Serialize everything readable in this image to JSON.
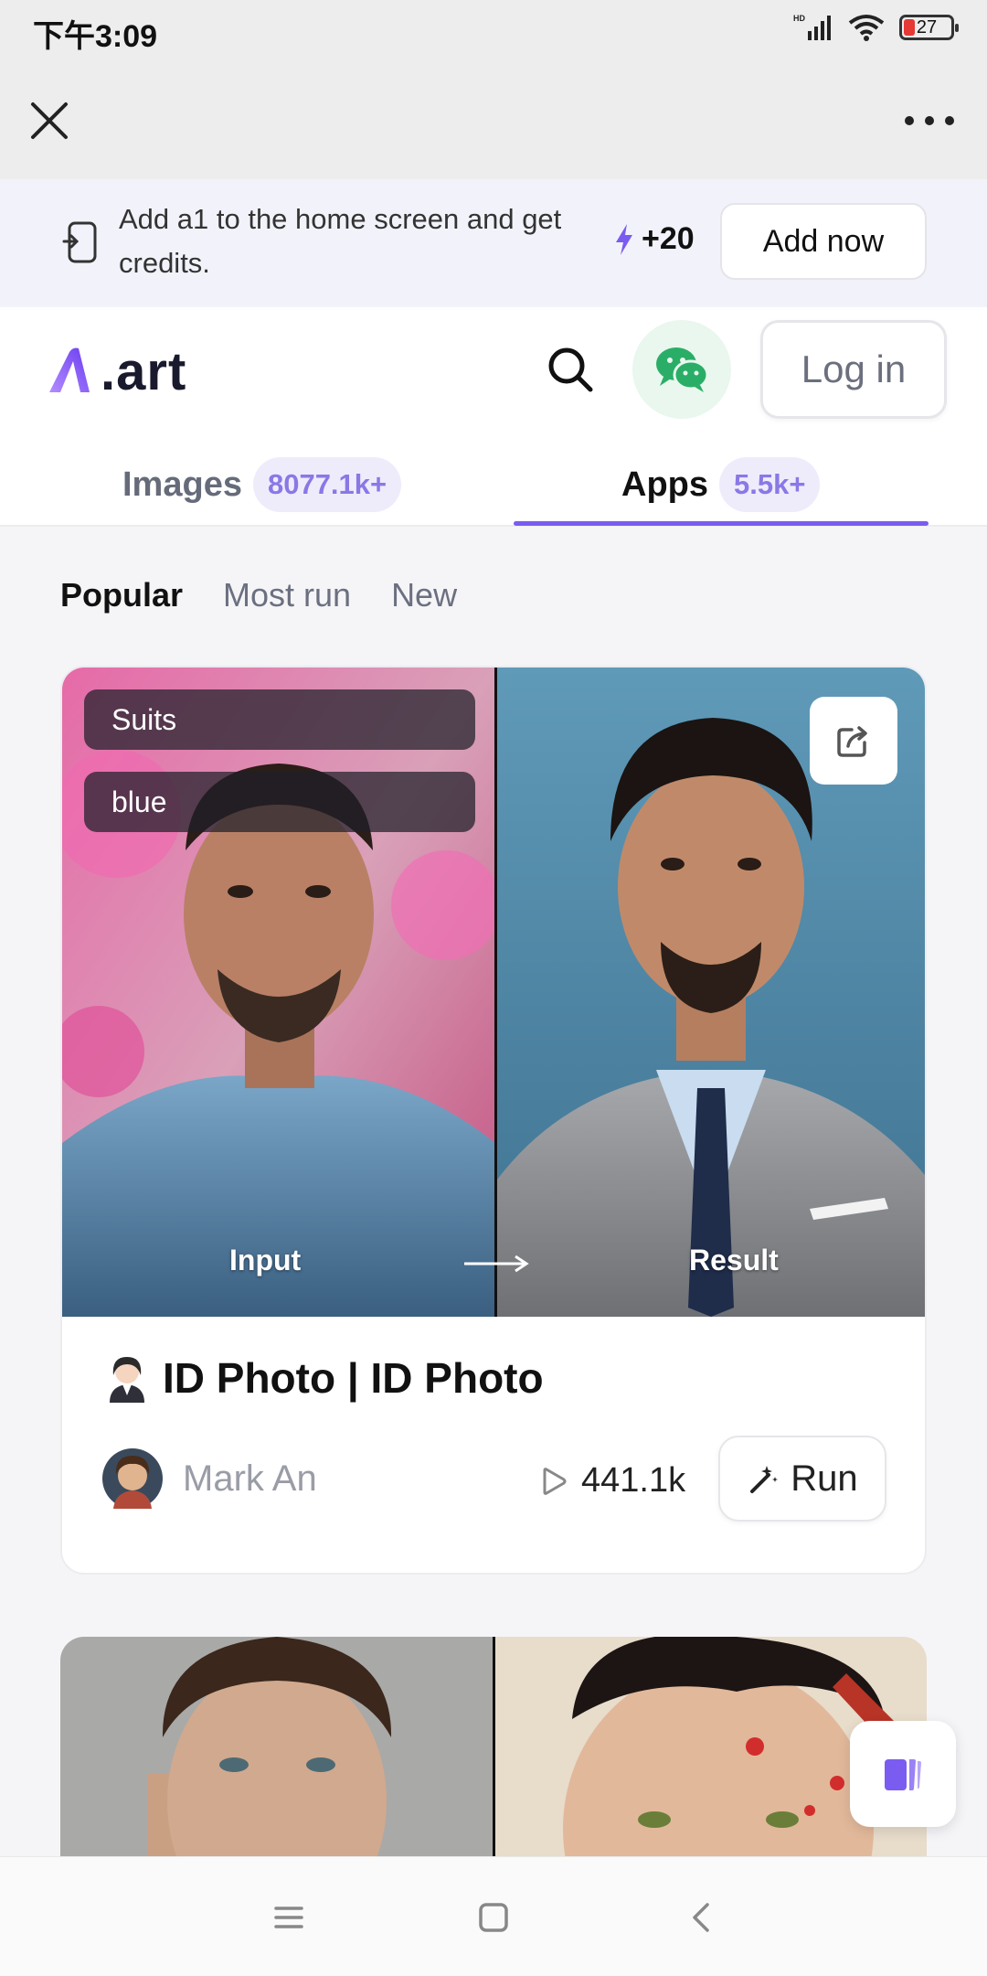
{
  "status_bar": {
    "time": "下午3:09",
    "battery": "27"
  },
  "banner": {
    "text": "Add a1 to the home screen and get credits.",
    "credits": "+20",
    "button": "Add now"
  },
  "header": {
    "logo_text": ".art",
    "login": "Log in"
  },
  "tabs": [
    {
      "label": "Images",
      "count": "8077.1k+"
    },
    {
      "label": "Apps",
      "count": "5.5k+"
    }
  ],
  "sort": [
    "Popular",
    "Most run",
    "New"
  ],
  "card": {
    "tags": [
      "Suits",
      "blue"
    ],
    "input_label": "Input",
    "result_label": "Result",
    "title": "ID Photo | ID Photo",
    "author": "Mark An",
    "runs": "441.1k",
    "run_button": "Run"
  },
  "colors": {
    "accent": "#7b5cf0",
    "wechat": "#2aae67"
  }
}
